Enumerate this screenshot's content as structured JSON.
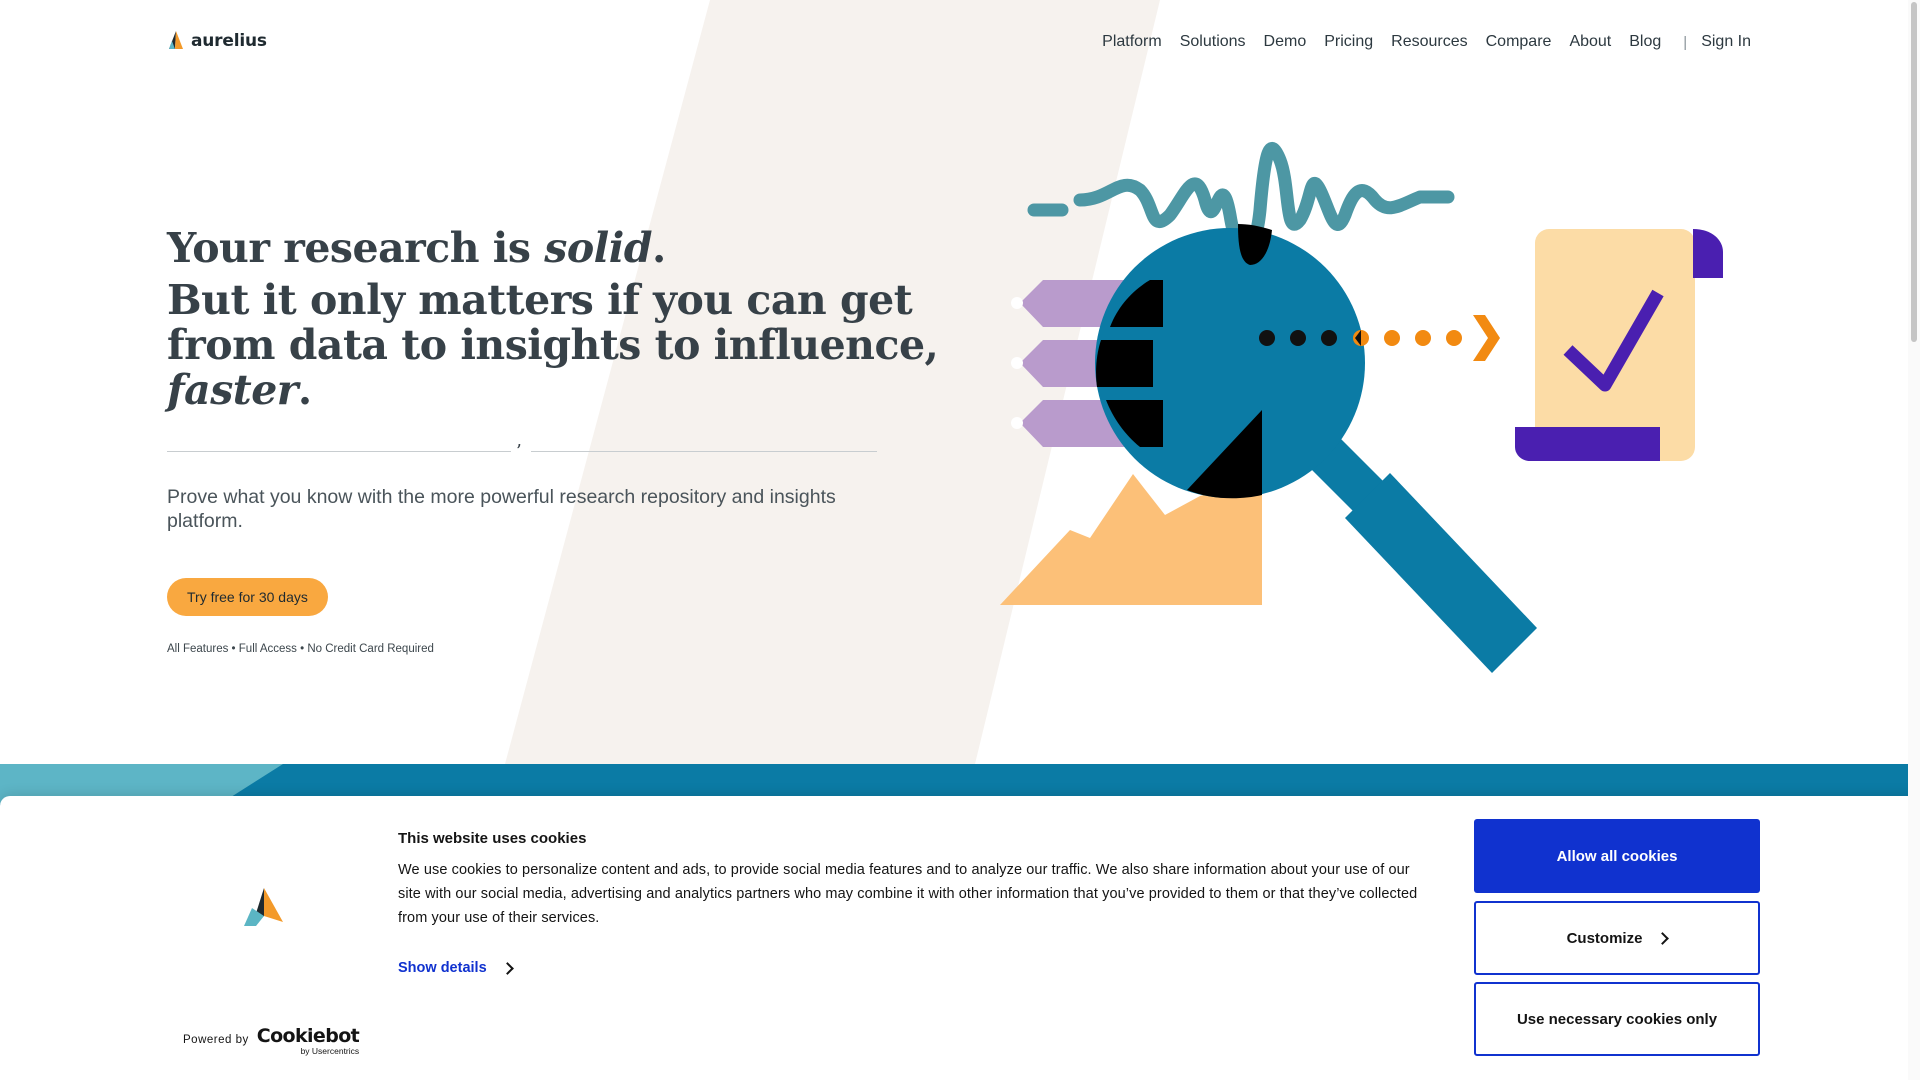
{
  "header": {
    "brand": "aurelius",
    "nav": [
      "Platform",
      "Solutions",
      "Demo",
      "Pricing",
      "Resources",
      "Compare",
      "About",
      "Blog"
    ],
    "separator": "|",
    "sign_in": "Sign In"
  },
  "hero": {
    "line1_prefix": "Your research is ",
    "line1_emph": "solid",
    "line1_suffix": ".",
    "line2_prefix": "But it only matters if you can get from data to insights to influence, ",
    "line2_emph": "faster",
    "line2_suffix": ".",
    "divider_mark": "’",
    "subtext": "Prove what you know with the more powerful research repository and insights platform.",
    "cta": "Try free for 30 days",
    "fineprint": "All Features • Full Access • No Credit Card Required"
  },
  "cookie": {
    "title": "This website uses cookies",
    "body": "We use cookies to personalize content and ads, to provide social media features and to analyze our traffic. We also share information about your use of our site with our social media, advertising and analytics partners who may combine it with other information that you’ve provided to them or that they’ve collected from your use of their services.",
    "show_details": "Show details",
    "powered_by": "Powered by",
    "brand": "Cookiebot",
    "brand_sub": "by Usercentrics",
    "allow_all": "Allow all cookies",
    "customize": "Customize",
    "necessary_only": "Use necessary cookies only"
  },
  "colors": {
    "accent_orange": "#f9a840",
    "brand_blue": "#0b7ba5",
    "cookie_blue": "#1032cf",
    "lavender": "#b99bcc",
    "purple": "#4a1fb0",
    "teal": "#4d97a4",
    "cream": "#fcdca6"
  },
  "icons": {
    "brand_logo": "aurelius-logo-icon",
    "show_details": "chevron-right-icon",
    "customize": "chevron-right-icon"
  }
}
